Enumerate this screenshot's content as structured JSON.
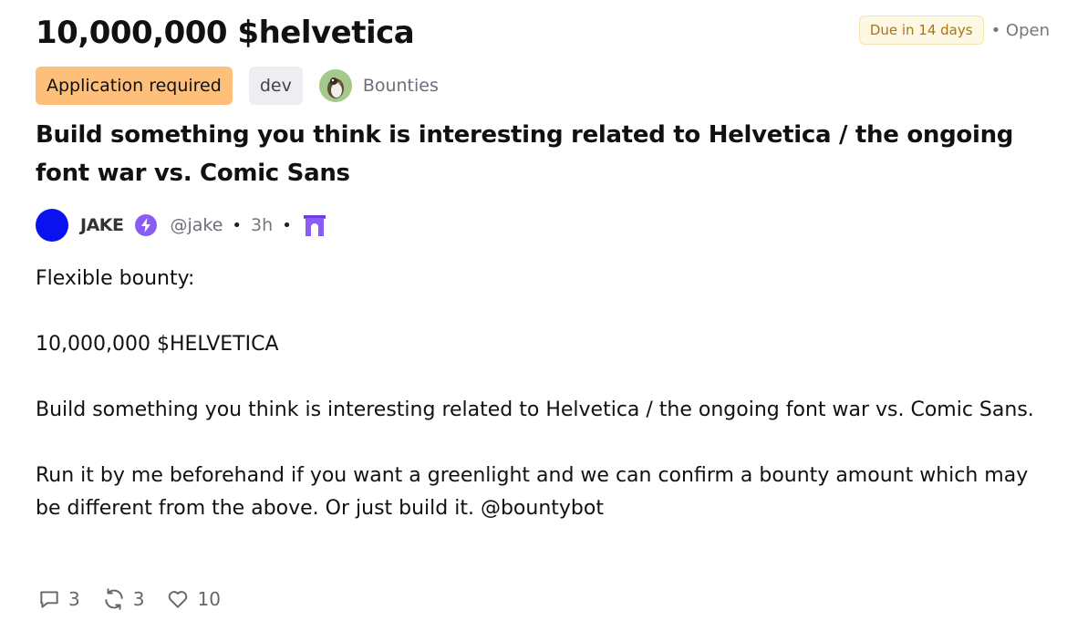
{
  "cast": {
    "title": "10,000,000 $helvetica",
    "due": "Due in 14 days",
    "status": "• Open",
    "tags": {
      "application": "Application required",
      "category": "dev"
    },
    "channel": {
      "name": "Bounties",
      "icon": "channel-avatar-icon"
    },
    "heading": "Build something you think is interesting related to Helvetica / the ongoing font war vs. Comic Sans",
    "author": {
      "name": "JAKE",
      "handle": "@jake",
      "time": "3h",
      "avatar_color": "#0a12f0",
      "badge_icon": "power-badge-icon",
      "client_icon": "arch-icon"
    },
    "body": {
      "line1": "Flexible bounty:",
      "line2": "10,000,000 $HELVETICA",
      "line3": "Build something you think is interesting related to Helvetica / the ongoing font war vs. Comic Sans.",
      "line4": "Run it by me beforehand if you want a greenlight and we can confirm a bounty amount which may be different from the above. Or just build it. @bountybot"
    },
    "actions": {
      "replies": "3",
      "recasts": "3",
      "likes": "10"
    }
  },
  "colors": {
    "accent_purple": "#8a5cf5",
    "application_tag": "#fdbf7a",
    "due_text": "#a8741a"
  }
}
